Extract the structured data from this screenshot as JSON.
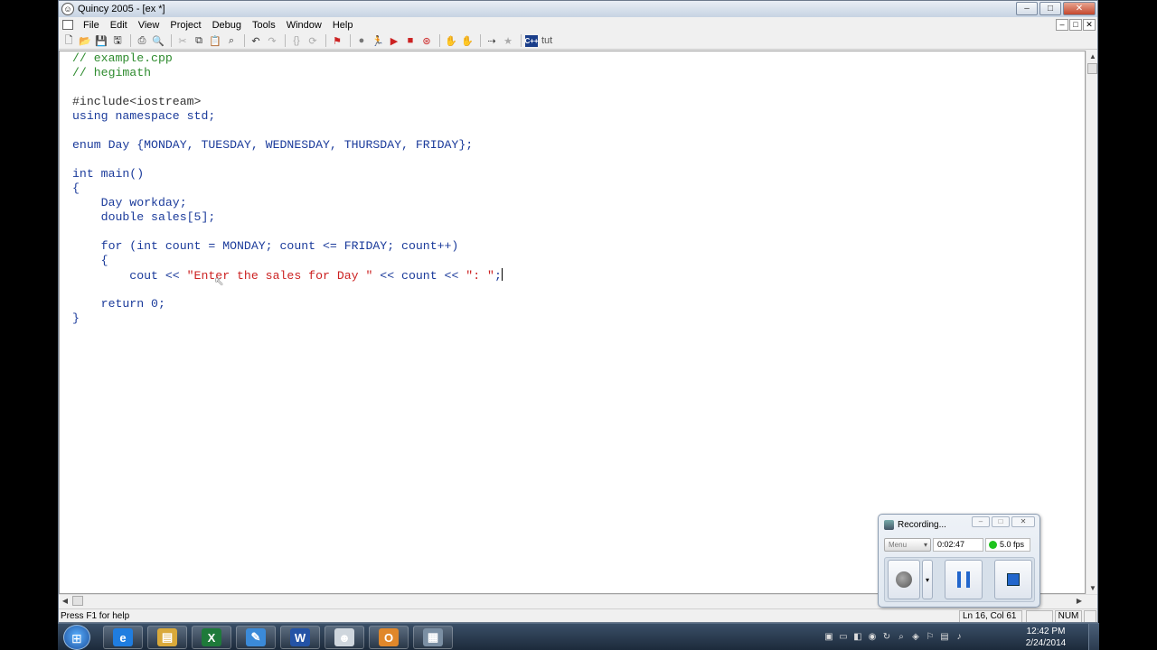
{
  "window": {
    "title": "Quincy 2005 - [ex *]",
    "controls": {
      "minimize": "–",
      "maximize": "□",
      "close": "✕"
    }
  },
  "menubar": {
    "items": [
      "File",
      "Edit",
      "View",
      "Project",
      "Debug",
      "Tools",
      "Window",
      "Help"
    ],
    "mdi_controls": {
      "minimize": "–",
      "restore": "□",
      "close": "✕"
    }
  },
  "toolbar": {
    "tut_label": "tut",
    "cpp_label": "C++",
    "icons": [
      "new-file-icon",
      "open-folder-icon",
      "save-icon",
      "save-all-icon",
      "print-icon",
      "print-preview-icon",
      "cut-icon",
      "copy-icon",
      "paste-icon",
      "find-icon",
      "undo-icon",
      "redo-icon",
      "bracket-match-icon",
      "step-icon",
      "build-icon",
      "compile-icon",
      "run-icon",
      "debug-run-icon",
      "stop-icon",
      "breakpoint-icon",
      "step-over-icon",
      "step-into-icon",
      "step-out-icon",
      "watch-icon",
      "help-icon"
    ]
  },
  "editor": {
    "lines": [
      [
        {
          "t": "// example.cpp",
          "c": "comment"
        }
      ],
      [
        {
          "t": "// hegimath",
          "c": "comment"
        }
      ],
      [
        {
          "t": "",
          "c": "plain"
        }
      ],
      [
        {
          "t": "#include<iostream>",
          "c": "pre"
        }
      ],
      [
        {
          "t": "using namespace std;",
          "c": "plain"
        }
      ],
      [
        {
          "t": "",
          "c": "plain"
        }
      ],
      [
        {
          "t": "enum Day {MONDAY, TUESDAY, WEDNESDAY, THURSDAY, FRIDAY};",
          "c": "plain"
        }
      ],
      [
        {
          "t": "",
          "c": "plain"
        }
      ],
      [
        {
          "t": "int main()",
          "c": "plain"
        }
      ],
      [
        {
          "t": "{",
          "c": "plain"
        }
      ],
      [
        {
          "t": "    Day workday;",
          "c": "plain"
        }
      ],
      [
        {
          "t": "    double sales[5];",
          "c": "plain"
        }
      ],
      [
        {
          "t": "",
          "c": "plain"
        }
      ],
      [
        {
          "t": "    for (int count = MONDAY; count <= FRIDAY; count++)",
          "c": "plain"
        }
      ],
      [
        {
          "t": "    {",
          "c": "plain"
        }
      ],
      [
        {
          "t": "        cout << ",
          "c": "plain"
        },
        {
          "t": "\"Enter the sales for Day \"",
          "c": "str"
        },
        {
          "t": " << count << ",
          "c": "plain"
        },
        {
          "t": "\": \"",
          "c": "str"
        },
        {
          "t": ";",
          "c": "plain"
        }
      ],
      [
        {
          "t": "",
          "c": "plain"
        }
      ],
      [
        {
          "t": "    return 0;",
          "c": "plain"
        }
      ],
      [
        {
          "t": "}",
          "c": "plain"
        }
      ]
    ],
    "caret_line": 15
  },
  "statusbar": {
    "help": "Press F1 for help",
    "position": "Ln 16, Col 61",
    "cap": "",
    "num": "NUM",
    "scrl": ""
  },
  "recorder": {
    "title": "Recording...",
    "menu_label": "Menu",
    "elapsed": "0:02:47",
    "fps": "5.0 fps",
    "status_color": "#1ec31e"
  },
  "taskbar": {
    "apps": [
      {
        "name": "internet-explorer",
        "glyph": "e",
        "color": "#1f7de0"
      },
      {
        "name": "file-explorer",
        "glyph": "▤",
        "color": "#d9a93a"
      },
      {
        "name": "excel",
        "glyph": "X",
        "color": "#1e7a3a"
      },
      {
        "name": "notepad",
        "glyph": "✎",
        "color": "#3b8ad8"
      },
      {
        "name": "word",
        "glyph": "W",
        "color": "#2453a6"
      },
      {
        "name": "quincy",
        "glyph": "☻",
        "color": "#cfd6dd"
      },
      {
        "name": "outlook",
        "glyph": "O",
        "color": "#e0872a"
      },
      {
        "name": "camtasia",
        "glyph": "▦",
        "color": "#7b8fa3"
      }
    ],
    "clock_time": "12:42 PM",
    "clock_date": "2/24/2014"
  }
}
